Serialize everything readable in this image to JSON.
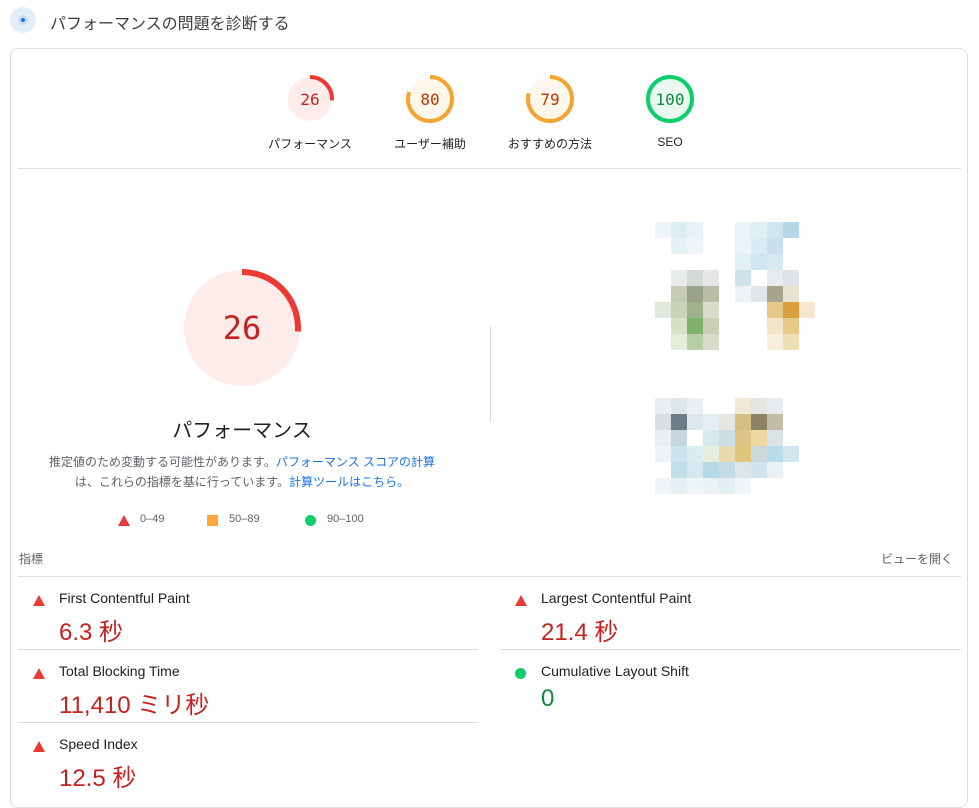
{
  "header": {
    "title": "パフォーマンスの問題を診断する"
  },
  "categories": [
    {
      "score": "26",
      "label": "パフォーマンス",
      "value": 0.26,
      "color": "#eb3a34",
      "bg": "#fdecea"
    },
    {
      "score": "80",
      "label": "ユーザー補助",
      "value": 0.8,
      "color": "#f4a433",
      "bg": "#fef7ec"
    },
    {
      "score": "79",
      "label": "おすすめの方法",
      "value": 0.79,
      "color": "#f4a433",
      "bg": "#fef7ec"
    },
    {
      "score": "100",
      "label": "SEO",
      "value": 1.0,
      "color": "#0cce6b",
      "bg": "#ebf8ef"
    }
  ],
  "main_gauge": {
    "score": "26",
    "value": 0.26,
    "title": "パフォーマンス",
    "color": "#eb3a34",
    "text_color": "#c5221f",
    "bg": "#fdecea",
    "desc_prefix": "推定値のため変動する可能性があります。",
    "desc_link1": "パフォーマンス スコアの計算",
    "desc_mid": "は、これらの指標を基に行っています。",
    "desc_link2": "計算ツールはこちら。"
  },
  "legend": [
    {
      "icon": "triangle-icon",
      "range": "0–49"
    },
    {
      "icon": "square-icon",
      "range": "50–89"
    },
    {
      "icon": "circle-icon",
      "range": "90–100"
    }
  ],
  "metrics_header": {
    "label": "指標",
    "expand": "ビューを開く"
  },
  "metrics": [
    {
      "name": "First Contentful Paint",
      "value": "6.3 秒",
      "status": "poor"
    },
    {
      "name": "Largest Contentful Paint",
      "value": "21.4 秒",
      "status": "poor"
    },
    {
      "name": "Total Blocking Time",
      "value": "11,410 ミリ秒",
      "status": "poor"
    },
    {
      "name": "Cumulative Layout Shift",
      "value": "0",
      "status": "good"
    },
    {
      "name": "Speed Index",
      "value": "12.5 秒",
      "status": "poor"
    }
  ],
  "colors": {
    "poor": "#eb3a34",
    "average": "#fca73a",
    "good": "#0cce6b",
    "link": "#1a73e8"
  }
}
